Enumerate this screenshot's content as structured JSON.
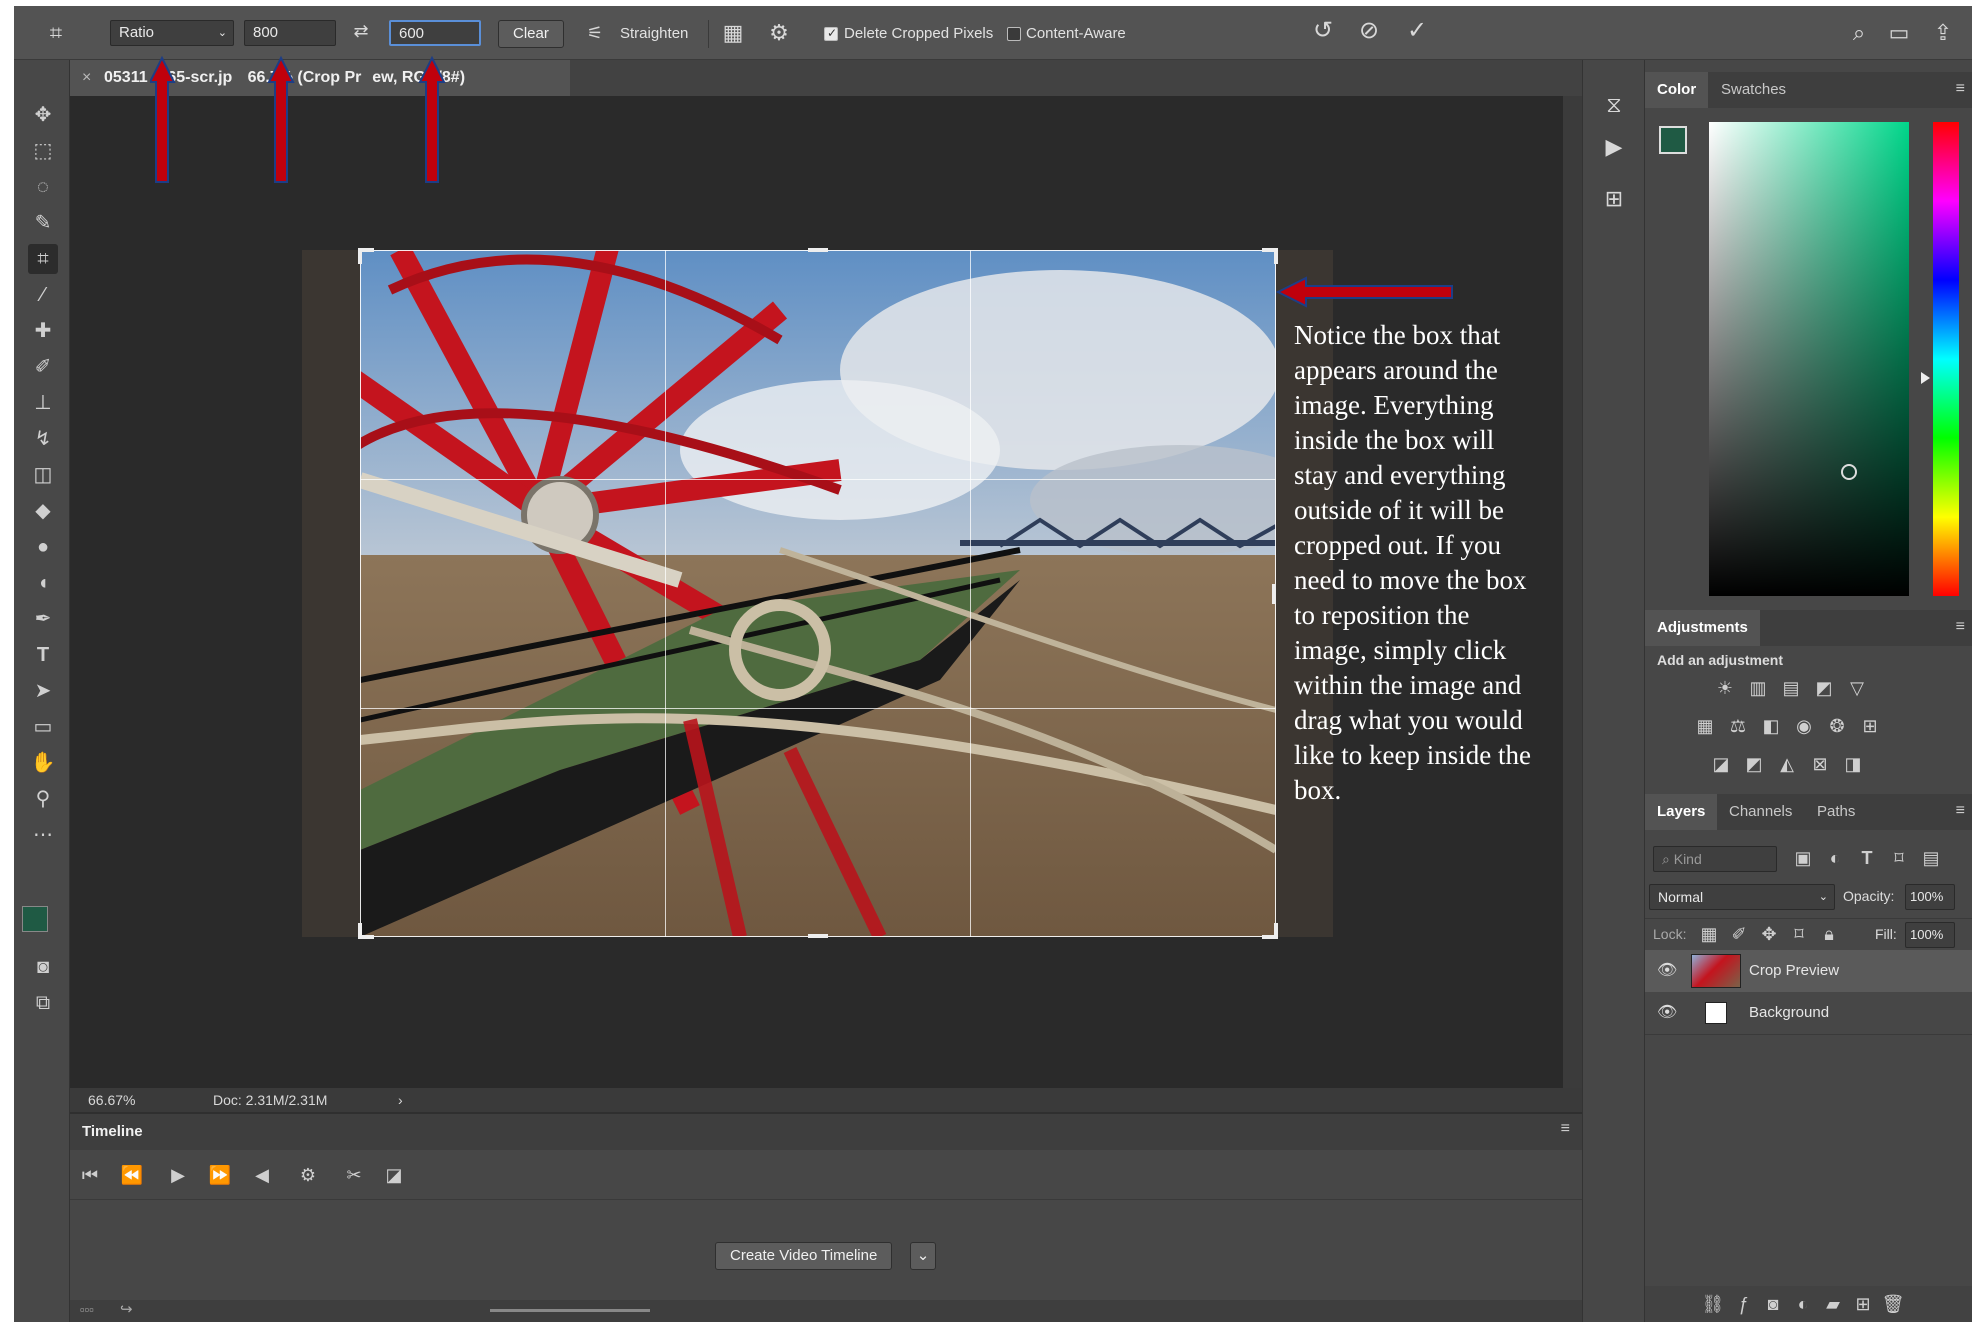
{
  "options_bar": {
    "ratio_label": "Ratio",
    "width_value": "800",
    "height_value": "600",
    "clear_label": "Clear",
    "straighten_label": "Straighten",
    "delete_cropped_label": "Delete Cropped Pixels",
    "delete_cropped_checked": true,
    "content_aware_label": "Content-Aware",
    "content_aware_checked": false
  },
  "document": {
    "tab_title": "05311   065-scr.jp    66.7% (Crop Pr   ew, RGB/8#)",
    "tab_close": "×",
    "zoom": "66.67%",
    "doc_info": "Doc: 2.31M/2.31M",
    "status_arrow": "›"
  },
  "annotation": {
    "text": "Notice the box that appears around the image. Everything inside the box will stay and everything outside of it will be cropped out. If you need to move the box to reposition the image, simply click within the image and drag what you would like to keep inside the box."
  },
  "timeline": {
    "title": "Timeline",
    "create_button": "Create Video Timeline"
  },
  "color_panel": {
    "tabs": [
      "Color",
      "Swatches"
    ],
    "foreground": "#1f5a44",
    "background": "#ffffff"
  },
  "adjustments_panel": {
    "title": "Adjustments",
    "subtitle": "Add an adjustment"
  },
  "layers_panel": {
    "tabs": [
      "Layers",
      "Channels",
      "Paths"
    ],
    "kind_placeholder": "Kind",
    "blend_mode": "Normal",
    "opacity_label": "Opacity:",
    "opacity_value": "100%",
    "lock_label": "Lock:",
    "fill_label": "Fill:",
    "fill_value": "100%",
    "layers": [
      {
        "name": "Crop Preview"
      },
      {
        "name": "Background"
      }
    ]
  },
  "colors": {
    "accent_red": "#c0000c",
    "panel_bg": "#474747",
    "canvas_bg": "#2a2a2a"
  }
}
